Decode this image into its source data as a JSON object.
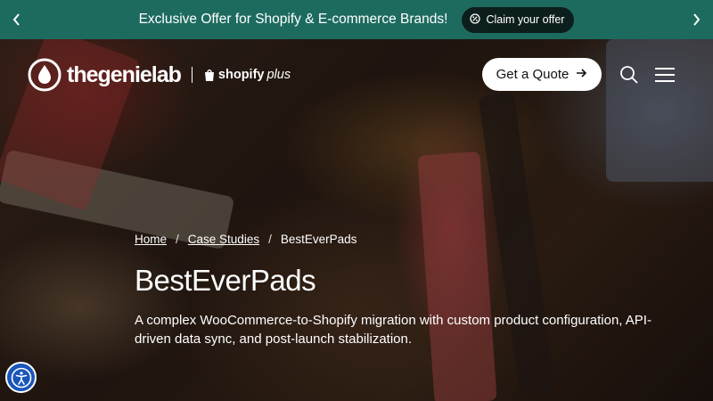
{
  "announcement": {
    "text": "Exclusive Offer for Shopify & E-commerce Brands!",
    "cta_label": "Claim your offer"
  },
  "header": {
    "brand_name": "thegenielab",
    "partner_bold": "shopify",
    "partner_italic": "plus",
    "quote_label": "Get a Quote"
  },
  "breadcrumb": {
    "items": [
      {
        "label": "Home"
      },
      {
        "label": "Case Studies"
      },
      {
        "label": "BestEverPads"
      }
    ],
    "separator": "/"
  },
  "hero": {
    "title": "BestEverPads",
    "description": "A complex WooCommerce-to-Shopify migration with custom product configuration, API-driven data sync, and post-launch stabilization."
  },
  "colors": {
    "announcement_bg": "#1d6b5f",
    "claim_button_bg": "#0c1f1c",
    "accessibility_button": "#1a56b8"
  },
  "icons": [
    "chevron-left-icon",
    "chevron-right-icon",
    "offer-badge-icon",
    "arrow-right-icon",
    "search-icon",
    "hamburger-menu-icon",
    "accessibility-icon",
    "genie-drop-icon",
    "shopify-bag-icon"
  ]
}
